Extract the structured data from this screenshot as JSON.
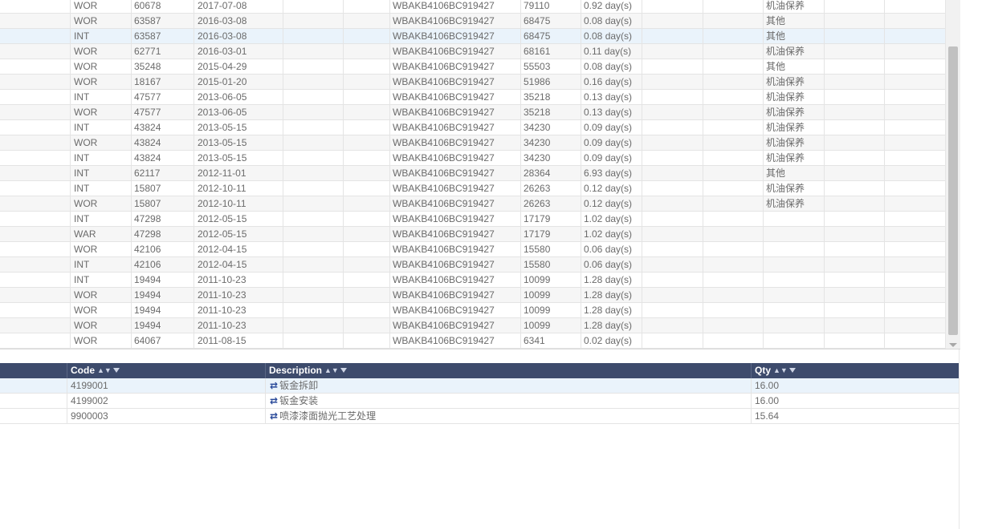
{
  "upper_grid": {
    "rows": [
      {
        "type": "WOR",
        "ref": "60678",
        "date": "2017-07-08",
        "vin": "WBAKB4106BC919427",
        "mileage": "79110",
        "duration": "0.92 day(s)",
        "category": "机油保养"
      },
      {
        "type": "WOR",
        "ref": "63587",
        "date": "2016-03-08",
        "vin": "WBAKB4106BC919427",
        "mileage": "68475",
        "duration": "0.08 day(s)",
        "category": "其他"
      },
      {
        "type": "INT",
        "ref": "63587",
        "date": "2016-03-08",
        "vin": "WBAKB4106BC919427",
        "mileage": "68475",
        "duration": "0.08 day(s)",
        "category": "其他"
      },
      {
        "type": "WOR",
        "ref": "62771",
        "date": "2016-03-01",
        "vin": "WBAKB4106BC919427",
        "mileage": "68161",
        "duration": "0.11 day(s)",
        "category": "机油保养"
      },
      {
        "type": "WOR",
        "ref": "35248",
        "date": "2015-04-29",
        "vin": "WBAKB4106BC919427",
        "mileage": "55503",
        "duration": "0.08 day(s)",
        "category": "其他"
      },
      {
        "type": "WOR",
        "ref": "18167",
        "date": "2015-01-20",
        "vin": "WBAKB4106BC919427",
        "mileage": "51986",
        "duration": "0.16 day(s)",
        "category": "机油保养"
      },
      {
        "type": "INT",
        "ref": "47577",
        "date": "2013-06-05",
        "vin": "WBAKB4106BC919427",
        "mileage": "35218",
        "duration": "0.13 day(s)",
        "category": "机油保养"
      },
      {
        "type": "WOR",
        "ref": "47577",
        "date": "2013-06-05",
        "vin": "WBAKB4106BC919427",
        "mileage": "35218",
        "duration": "0.13 day(s)",
        "category": "机油保养"
      },
      {
        "type": "INT",
        "ref": "43824",
        "date": "2013-05-15",
        "vin": "WBAKB4106BC919427",
        "mileage": "34230",
        "duration": "0.09 day(s)",
        "category": "机油保养"
      },
      {
        "type": "WOR",
        "ref": "43824",
        "date": "2013-05-15",
        "vin": "WBAKB4106BC919427",
        "mileage": "34230",
        "duration": "0.09 day(s)",
        "category": "机油保养"
      },
      {
        "type": "INT",
        "ref": "43824",
        "date": "2013-05-15",
        "vin": "WBAKB4106BC919427",
        "mileage": "34230",
        "duration": "0.09 day(s)",
        "category": "机油保养"
      },
      {
        "type": "INT",
        "ref": "62117",
        "date": "2012-11-01",
        "vin": "WBAKB4106BC919427",
        "mileage": "28364",
        "duration": "6.93 day(s)",
        "category": "其他"
      },
      {
        "type": "INT",
        "ref": "15807",
        "date": "2012-10-11",
        "vin": "WBAKB4106BC919427",
        "mileage": "26263",
        "duration": "0.12 day(s)",
        "category": "机油保养"
      },
      {
        "type": "WOR",
        "ref": "15807",
        "date": "2012-10-11",
        "vin": "WBAKB4106BC919427",
        "mileage": "26263",
        "duration": "0.12 day(s)",
        "category": "机油保养"
      },
      {
        "type": "INT",
        "ref": "47298",
        "date": "2012-05-15",
        "vin": "WBAKB4106BC919427",
        "mileage": "17179",
        "duration": "1.02 day(s)",
        "category": ""
      },
      {
        "type": "WAR",
        "ref": "47298",
        "date": "2012-05-15",
        "vin": "WBAKB4106BC919427",
        "mileage": "17179",
        "duration": "1.02 day(s)",
        "category": ""
      },
      {
        "type": "WOR",
        "ref": "42106",
        "date": "2012-04-15",
        "vin": "WBAKB4106BC919427",
        "mileage": "15580",
        "duration": "0.06 day(s)",
        "category": ""
      },
      {
        "type": "INT",
        "ref": "42106",
        "date": "2012-04-15",
        "vin": "WBAKB4106BC919427",
        "mileage": "15580",
        "duration": "0.06 day(s)",
        "category": ""
      },
      {
        "type": "INT",
        "ref": "19494",
        "date": "2011-10-23",
        "vin": "WBAKB4106BC919427",
        "mileage": "10099",
        "duration": "1.28 day(s)",
        "category": ""
      },
      {
        "type": "WOR",
        "ref": "19494",
        "date": "2011-10-23",
        "vin": "WBAKB4106BC919427",
        "mileage": "10099",
        "duration": "1.28 day(s)",
        "category": ""
      },
      {
        "type": "WOR",
        "ref": "19494",
        "date": "2011-10-23",
        "vin": "WBAKB4106BC919427",
        "mileage": "10099",
        "duration": "1.28 day(s)",
        "category": ""
      },
      {
        "type": "WOR",
        "ref": "19494",
        "date": "2011-10-23",
        "vin": "WBAKB4106BC919427",
        "mileage": "10099",
        "duration": "1.28 day(s)",
        "category": ""
      },
      {
        "type": "WOR",
        "ref": "64067",
        "date": "2011-08-15",
        "vin": "WBAKB4106BC919427",
        "mileage": "6341",
        "duration": "0.02 day(s)",
        "category": ""
      }
    ]
  },
  "lower_grid": {
    "headers": {
      "code": "Code",
      "description": "Description",
      "qty": "Qty"
    },
    "rows": [
      {
        "code": "4199001",
        "description": "钣金拆卸",
        "qty": "16.00"
      },
      {
        "code": "4199002",
        "description": "钣金安装",
        "qty": "16.00"
      },
      {
        "code": "9900003",
        "description": "喷漆漆面抛光工艺处理",
        "qty": "15.64"
      }
    ],
    "link_icon": "⇄",
    "sort_icon": "▲▼"
  },
  "colors": {
    "header_bg": "#3d4b6c",
    "selected_row": "#eaf3fb",
    "link_icon": "#2a4a9a"
  }
}
